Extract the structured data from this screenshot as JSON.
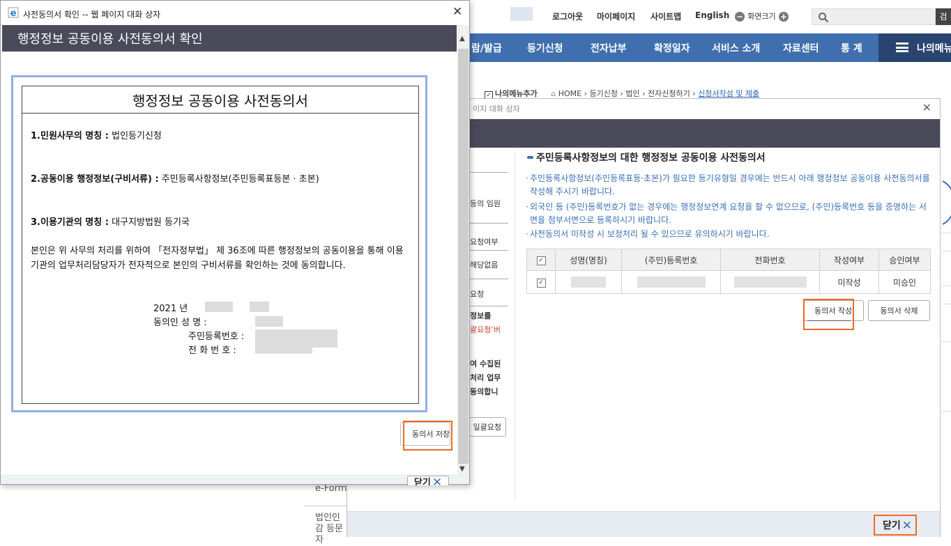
{
  "header": {
    "logout": "로그아웃",
    "mypage": "마이페이지",
    "sitemap": "사이트맵",
    "english": "English",
    "zoom_label": "화면크기",
    "zoom_minus": "−",
    "zoom_plus": "+",
    "search_button": "검"
  },
  "gnb": {
    "items": [
      "람/발급",
      "등기신청",
      "전자납부",
      "확정일자",
      "서비스 소개",
      "자료센터",
      "통 계"
    ],
    "my_menu": "나의메뉴"
  },
  "breadcrumb": {
    "add_menu": "나의메뉴추가",
    "items": [
      "HOME",
      "등기신청",
      "법인",
      "전자신청하기"
    ],
    "current": "신청서작성 및 제출"
  },
  "behind": {
    "text1": "e-Form",
    "text2": "법인인감 등문자"
  },
  "dialog2": {
    "title": "이지 대화 상자",
    "section_title": "주민등록사항정보의 대한 행정정보 공동이용 사전동의서",
    "notes": [
      "주민등록사항정보(주민등록표등·초본)가 필요한 등기유형일 경우에는 반드시 아래 행정정보 공동이용 사전동의서를 작성해 주시기 바랍니다.",
      "외국인 등 (주민)등록번호가 없는 경우에는 행정정보연계 요청을 할 수 없으므로, (주민)등록번호 등을 증명하는 서면을 첨부서면으로 등록하시기 바랍니다.",
      "사전동의서 미작성 시 보정처리 될 수 있으므로 유의하시기 바랍니다."
    ],
    "table": {
      "headers": [
        "성명(명칭)",
        "(주민)등록번호",
        "전화번호",
        "작성여부",
        "승인여부"
      ],
      "row": {
        "status": "미작성",
        "approval": "미승인"
      }
    },
    "write_button": "동의서 작성",
    "delete_button": "동의서 삭제",
    "close_button": "닫기",
    "left_column": {
      "t1": "등의 임원",
      "t2": "요청여부",
      "t3": "해당없음",
      "t4": "요청",
      "t5": "정보를",
      "t6": "괄요청’버",
      "t7": "여 수집된",
      "t8": "처리 업무",
      "t9": "동의합니",
      "bulk_button": "일괄요청"
    }
  },
  "dialog1": {
    "window_title": "사전동의서 확인 -- 웹 페이지 대화 상자",
    "header_title": "행정정보 공동이용 사전동의서 확인",
    "doc": {
      "title": "행정정보 공동이용 사전동의서",
      "item1_label": "1.민원사무의 명칭 :",
      "item1_value": "법인등기신청",
      "item2_label": "2.공동이용 행정정보(구비서류) :",
      "item2_value": "주민등록사항정보(주민등록표등본 · 초본)",
      "item3_label": "3.이용기관의 명칭 :",
      "item3_value": "대구지방법원 등기국",
      "paragraph": "본인은 위 사무의 처리를 위하여 「전자정부법」 제 36조에 따른 행정정보의 공동이용을 통해 이용기관의 업무처리담당자가 전자적으로 본인의 구비서류를 확인하는 것에 동의합니다.",
      "year": "2021 년",
      "sig_name_label": "동의인  성        명 :",
      "sig_id_label": "주민등록번호 :",
      "sig_phone_label": "전  화  번  호 :"
    },
    "save_button": "동의서 저장",
    "close_button": "닫기"
  },
  "colors": {
    "nav_blue": "#3f6fae",
    "dialog_header": "#4a4a5a",
    "highlight_orange": "#ef6a23",
    "note_blue": "#3a6fb5"
  },
  "icons": [
    "ie-icon",
    "search-icon",
    "close-icon",
    "hamburger-icon",
    "home-icon",
    "checkbox-icon"
  ]
}
